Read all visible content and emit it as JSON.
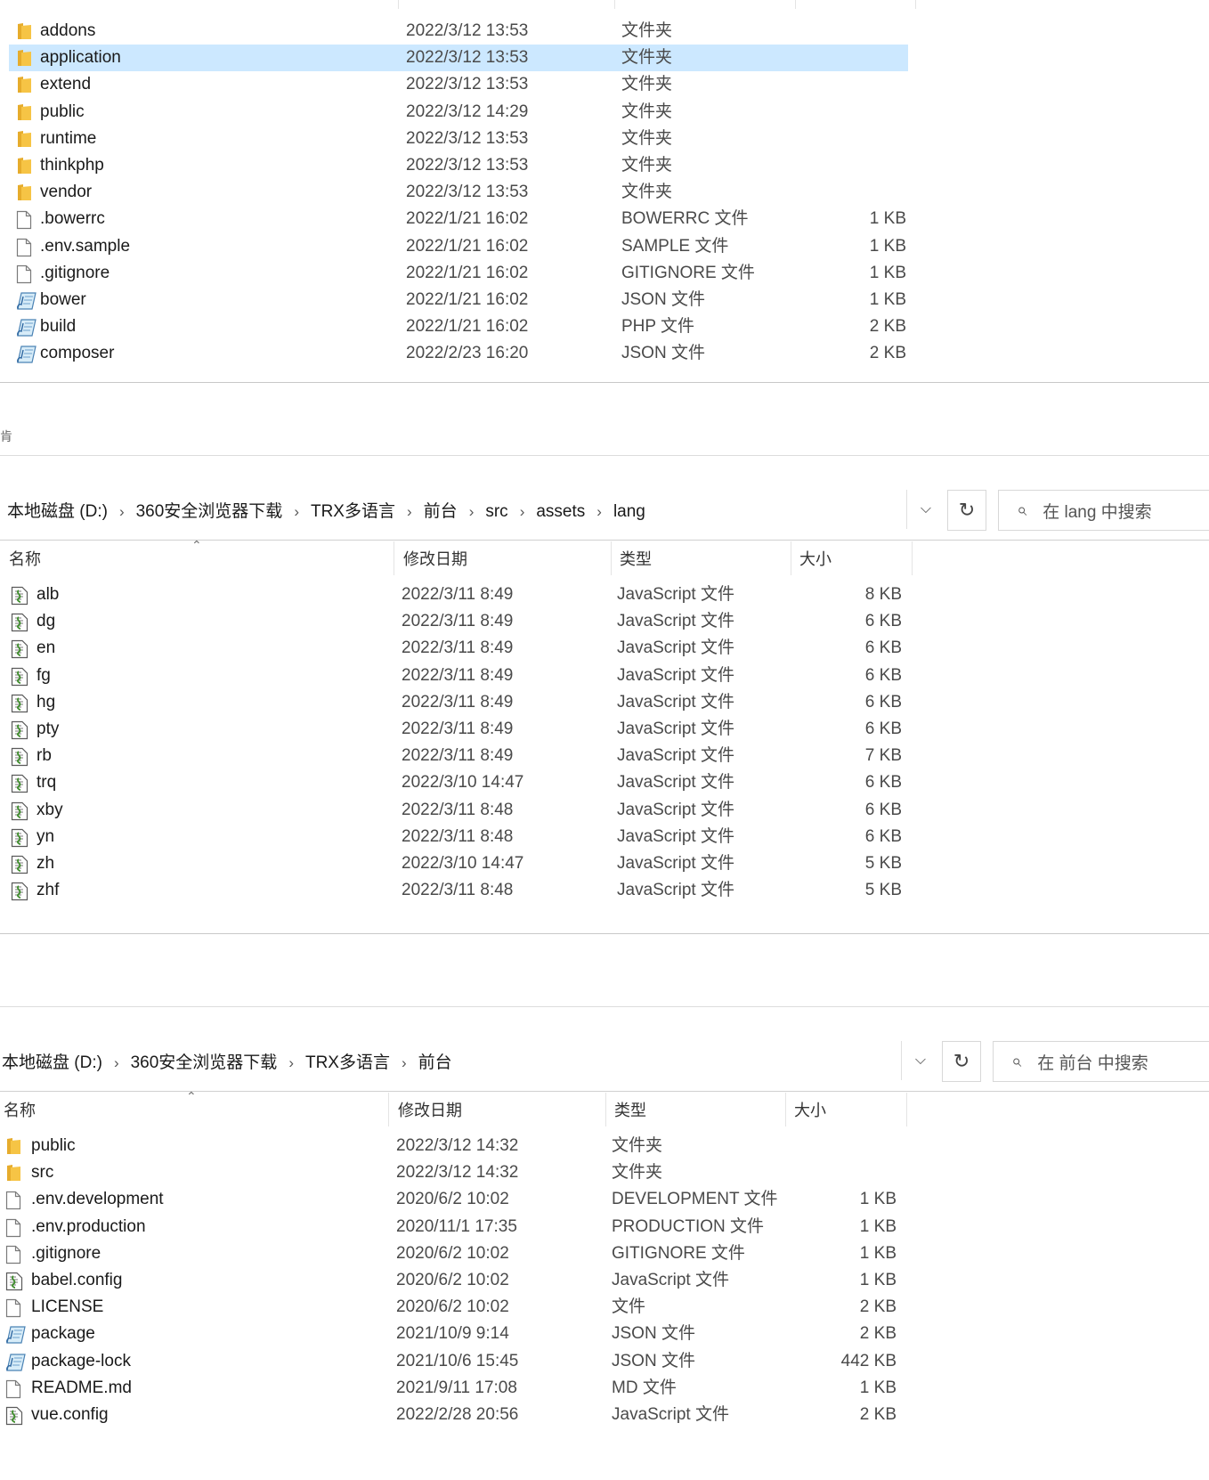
{
  "colors": {
    "selection": "#cce8ff",
    "folder": "#f6c445",
    "separator": "#c8c8c8"
  },
  "panel1": {
    "rows": [
      {
        "name": "addons",
        "date": "2022/3/12 13:53",
        "type": "文件夹",
        "size": "",
        "icon": "folder-icon"
      },
      {
        "name": "application",
        "date": "2022/3/12 13:53",
        "type": "文件夹",
        "size": "",
        "icon": "folder-icon",
        "selected": true
      },
      {
        "name": "extend",
        "date": "2022/3/12 13:53",
        "type": "文件夹",
        "size": "",
        "icon": "folder-icon"
      },
      {
        "name": "public",
        "date": "2022/3/12 14:29",
        "type": "文件夹",
        "size": "",
        "icon": "folder-icon"
      },
      {
        "name": "runtime",
        "date": "2022/3/12 13:53",
        "type": "文件夹",
        "size": "",
        "icon": "folder-icon"
      },
      {
        "name": "thinkphp",
        "date": "2022/3/12 13:53",
        "type": "文件夹",
        "size": "",
        "icon": "folder-icon"
      },
      {
        "name": "vendor",
        "date": "2022/3/12 13:53",
        "type": "文件夹",
        "size": "",
        "icon": "folder-icon"
      },
      {
        "name": ".bowerrc",
        "date": "2022/1/21 16:02",
        "type": "BOWERRC 文件",
        "size": "1 KB",
        "icon": "file-icon"
      },
      {
        "name": ".env.sample",
        "date": "2022/1/21 16:02",
        "type": "SAMPLE 文件",
        "size": "1 KB",
        "icon": "file-icon"
      },
      {
        "name": ".gitignore",
        "date": "2022/1/21 16:02",
        "type": "GITIGNORE 文件",
        "size": "1 KB",
        "icon": "file-icon"
      },
      {
        "name": "bower",
        "date": "2022/1/21 16:02",
        "type": "JSON 文件",
        "size": "1 KB",
        "icon": "script-file-icon"
      },
      {
        "name": "build",
        "date": "2022/1/21 16:02",
        "type": "PHP 文件",
        "size": "2 KB",
        "icon": "script-file-icon"
      },
      {
        "name": "composer",
        "date": "2022/2/23 16:20",
        "type": "JSON 文件",
        "size": "2 KB",
        "icon": "script-file-icon"
      }
    ]
  },
  "stray_glyph": "肯",
  "panel2": {
    "breadcrumb": [
      "本地磁盘 (D:)",
      "360安全浏览器下载",
      "TRX多语言",
      "前台",
      "src",
      "assets",
      "lang"
    ],
    "search_placeholder": "在 lang 中搜索",
    "headers": {
      "name": "名称",
      "date": "修改日期",
      "type": "类型",
      "size": "大小"
    },
    "rows": [
      {
        "name": "alb",
        "date": "2022/3/11 8:49",
        "type": "JavaScript 文件",
        "size": "8 KB",
        "icon": "js-file-icon"
      },
      {
        "name": "dg",
        "date": "2022/3/11 8:49",
        "type": "JavaScript 文件",
        "size": "6 KB",
        "icon": "js-file-icon"
      },
      {
        "name": "en",
        "date": "2022/3/11 8:49",
        "type": "JavaScript 文件",
        "size": "6 KB",
        "icon": "js-file-icon"
      },
      {
        "name": "fg",
        "date": "2022/3/11 8:49",
        "type": "JavaScript 文件",
        "size": "6 KB",
        "icon": "js-file-icon"
      },
      {
        "name": "hg",
        "date": "2022/3/11 8:49",
        "type": "JavaScript 文件",
        "size": "6 KB",
        "icon": "js-file-icon"
      },
      {
        "name": "pty",
        "date": "2022/3/11 8:49",
        "type": "JavaScript 文件",
        "size": "6 KB",
        "icon": "js-file-icon"
      },
      {
        "name": "rb",
        "date": "2022/3/11 8:49",
        "type": "JavaScript 文件",
        "size": "7 KB",
        "icon": "js-file-icon"
      },
      {
        "name": "trq",
        "date": "2022/3/10 14:47",
        "type": "JavaScript 文件",
        "size": "6 KB",
        "icon": "js-file-icon"
      },
      {
        "name": "xby",
        "date": "2022/3/11 8:48",
        "type": "JavaScript 文件",
        "size": "6 KB",
        "icon": "js-file-icon"
      },
      {
        "name": "yn",
        "date": "2022/3/11 8:48",
        "type": "JavaScript 文件",
        "size": "6 KB",
        "icon": "js-file-icon"
      },
      {
        "name": "zh",
        "date": "2022/3/10 14:47",
        "type": "JavaScript 文件",
        "size": "5 KB",
        "icon": "js-file-icon"
      },
      {
        "name": "zhf",
        "date": "2022/3/11 8:48",
        "type": "JavaScript 文件",
        "size": "5 KB",
        "icon": "js-file-icon"
      }
    ]
  },
  "panel3": {
    "breadcrumb": [
      "本地磁盘 (D:)",
      "360安全浏览器下载",
      "TRX多语言",
      "前台"
    ],
    "search_placeholder": "在 前台 中搜索",
    "headers": {
      "name": "名称",
      "date": "修改日期",
      "type": "类型",
      "size": "大小"
    },
    "rows": [
      {
        "name": "public",
        "date": "2022/3/12 14:32",
        "type": "文件夹",
        "size": "",
        "icon": "folder-icon"
      },
      {
        "name": "src",
        "date": "2022/3/12 14:32",
        "type": "文件夹",
        "size": "",
        "icon": "folder-icon"
      },
      {
        "name": ".env.development",
        "date": "2020/6/2 10:02",
        "type": "DEVELOPMENT 文件",
        "size": "1 KB",
        "icon": "file-icon"
      },
      {
        "name": ".env.production",
        "date": "2020/11/1 17:35",
        "type": "PRODUCTION 文件",
        "size": "1 KB",
        "icon": "file-icon"
      },
      {
        "name": ".gitignore",
        "date": "2020/6/2 10:02",
        "type": "GITIGNORE 文件",
        "size": "1 KB",
        "icon": "file-icon"
      },
      {
        "name": "babel.config",
        "date": "2020/6/2 10:02",
        "type": "JavaScript 文件",
        "size": "1 KB",
        "icon": "js-file-icon"
      },
      {
        "name": "LICENSE",
        "date": "2020/6/2 10:02",
        "type": "文件",
        "size": "2 KB",
        "icon": "file-icon"
      },
      {
        "name": "package",
        "date": "2021/10/9 9:14",
        "type": "JSON 文件",
        "size": "2 KB",
        "icon": "script-file-icon"
      },
      {
        "name": "package-lock",
        "date": "2021/10/6 15:45",
        "type": "JSON 文件",
        "size": "442 KB",
        "icon": "script-file-icon"
      },
      {
        "name": "README.md",
        "date": "2021/9/11 17:08",
        "type": "MD 文件",
        "size": "1 KB",
        "icon": "file-icon"
      },
      {
        "name": "vue.config",
        "date": "2022/2/28 20:56",
        "type": "JavaScript 文件",
        "size": "2 KB",
        "icon": "js-file-icon"
      }
    ]
  }
}
